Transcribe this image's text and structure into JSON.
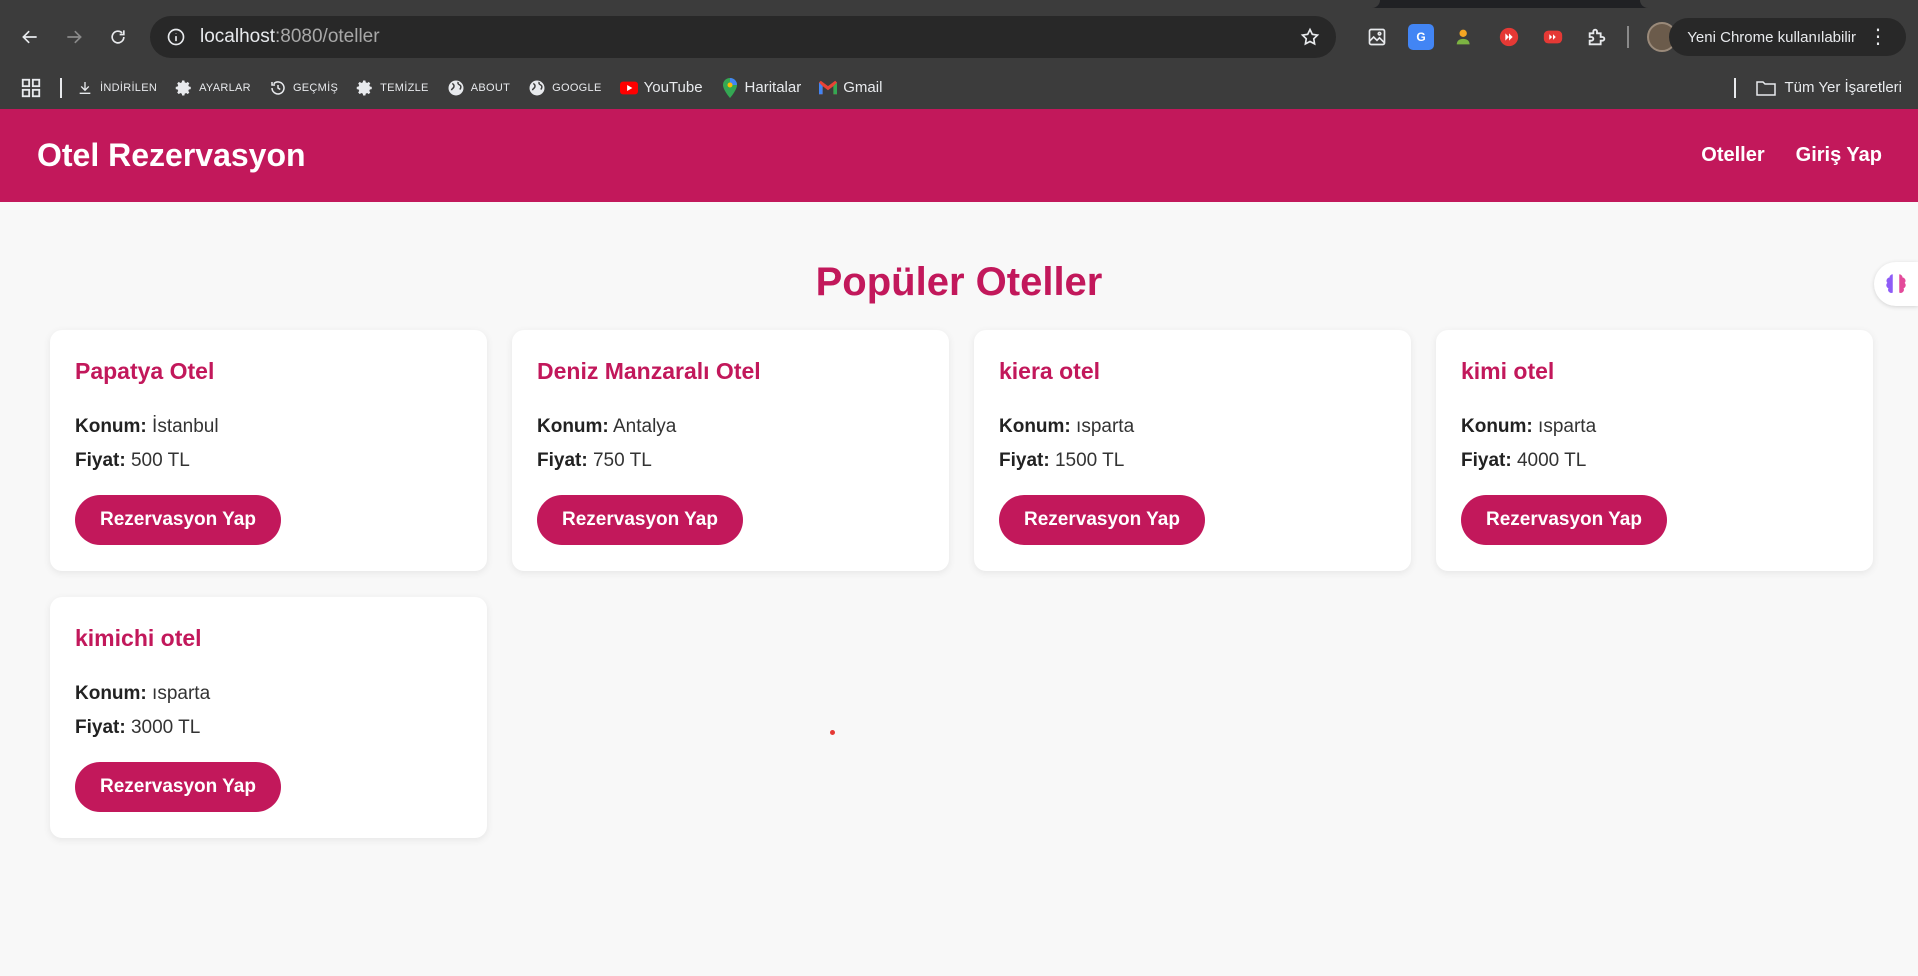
{
  "browser": {
    "url_host": "localhost",
    "url_path": ":8080/oteller",
    "update_label": "Yeni Chrome kullanılabilir",
    "bookmarks": [
      {
        "label": "İNDİRİLEN",
        "icon": "download-icon"
      },
      {
        "label": "AYARLAR",
        "icon": "gear-icon"
      },
      {
        "label": "GEÇMİŞ",
        "icon": "history-icon"
      },
      {
        "label": "TEMİZLE",
        "icon": "gear-icon"
      },
      {
        "label": "ABOUT",
        "icon": "globe-icon"
      },
      {
        "label": "GOOGLE",
        "icon": "globe-icon"
      },
      {
        "label": "YouTube",
        "icon": "youtube-icon"
      },
      {
        "label": "Haritalar",
        "icon": "maps-icon"
      },
      {
        "label": "Gmail",
        "icon": "gmail-icon"
      }
    ],
    "all_bookmarks_label": "Tüm Yer İşaretleri"
  },
  "site": {
    "brand": "Otel Rezervasyon",
    "nav": {
      "hotels": "Oteller",
      "login": "Giriş Yap"
    },
    "page_title": "Popüler Oteller",
    "location_label": "Konum:",
    "price_label": "Fiyat:",
    "book_button": "Rezervasyon Yap",
    "hotels": [
      {
        "name": "Papatya Otel",
        "location": "İstanbul",
        "price": "500 TL"
      },
      {
        "name": "Deniz Manzaralı Otel",
        "location": "Antalya",
        "price": "750 TL"
      },
      {
        "name": "kiera otel",
        "location": "ısparta",
        "price": "1500 TL"
      },
      {
        "name": "kimi otel",
        "location": "ısparta",
        "price": "4000 TL"
      },
      {
        "name": "kimichi otel",
        "location": "ısparta",
        "price": "3000 TL"
      }
    ]
  },
  "colors": {
    "brand": "#c2185b",
    "browser_chrome": "#3c3c3c"
  }
}
